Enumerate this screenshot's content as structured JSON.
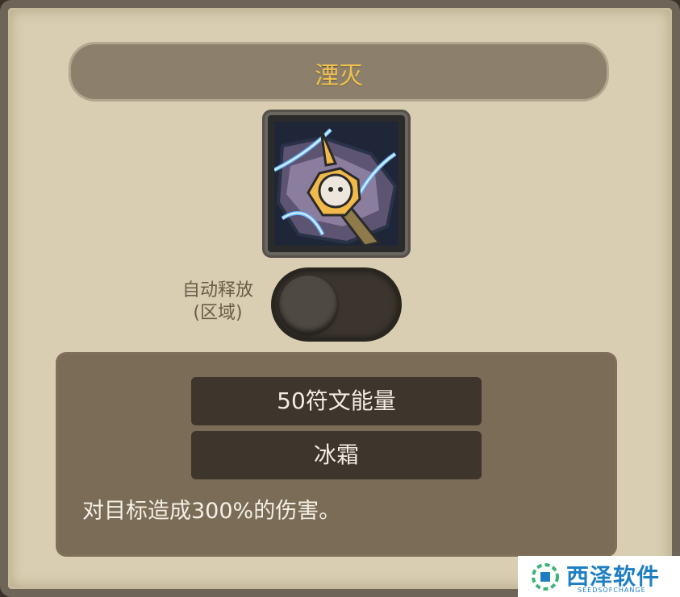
{
  "skill": {
    "name": "湮灭",
    "icon": "annihilation-skill-icon"
  },
  "auto_cast": {
    "label_line1": "自动释放",
    "label_line2": "(区域)",
    "enabled": false
  },
  "details": {
    "cost": "50符文能量",
    "element": "冰霜",
    "description": "对目标造成300%的伤害。"
  },
  "watermark": {
    "title": "西泽软件",
    "subtitle": "SEEDSOFCHANGE"
  },
  "colors": {
    "title": "#f1c24b",
    "panel": "#7b6c58",
    "pill": "#3e352c",
    "parchment": "#d9ceb1"
  }
}
